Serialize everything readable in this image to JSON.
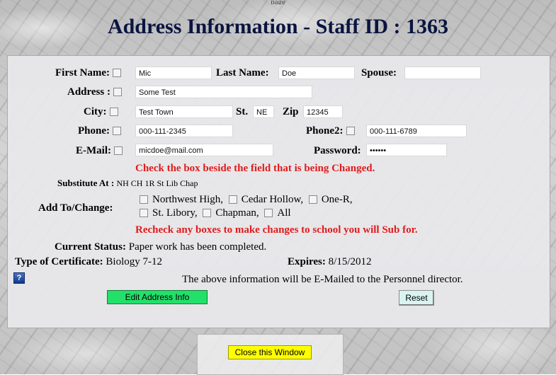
{
  "top_note": "page",
  "title": "Address Information - Staff ID : 1363",
  "labels": {
    "first_name": "First Name:",
    "last_name": "Last Name:",
    "spouse": "Spouse:",
    "address": "Address :",
    "city": "City:",
    "state": "St.",
    "zip": "Zip",
    "phone": "Phone:",
    "phone2": "Phone2:",
    "email": "E-Mail:",
    "password": "Password:",
    "substitute_at": "Substitute At :",
    "add_to_change": "Add To/Change:",
    "current_status": "Current Status:",
    "type_of_certificate": "Type of Certificate:",
    "expires": "Expires:"
  },
  "fields": {
    "first_name": "Mic",
    "last_name": "Doe",
    "spouse": "",
    "address": "Some Test",
    "city": "Test Town",
    "state": "NE",
    "zip": "12345",
    "phone": "000-111-2345",
    "phone2": "000-111-6789",
    "email": "micdoe@mail.com",
    "password": "••••••"
  },
  "messages": {
    "check_box": "Check the box beside the field that is being Changed.",
    "recheck": "Recheck any boxes to make changes to school you will Sub for.",
    "email_notice": "The above information will be E-Mailed to the Personnel director."
  },
  "substitute_at_value": "NH CH 1R St Lib Chap",
  "schools": [
    "Northwest High,",
    "Cedar Hollow,",
    "One-R,",
    "St. Libory,",
    "Chapman,",
    "All"
  ],
  "current_status_value": "Paper work has been completed.",
  "certificate_value": "Biology 7-12",
  "expires_value": "8/15/2012",
  "buttons": {
    "edit": "Edit Address Info",
    "reset": "Reset",
    "close": "Close this Window"
  },
  "colors": {
    "edit_button": "#22e06a",
    "reset_button": "#d9f4f0",
    "close_button": "#ffff00",
    "warning_text": "#e11b1b",
    "title_text": "#0a1440"
  },
  "icons": {
    "help": "help-question-icon"
  }
}
